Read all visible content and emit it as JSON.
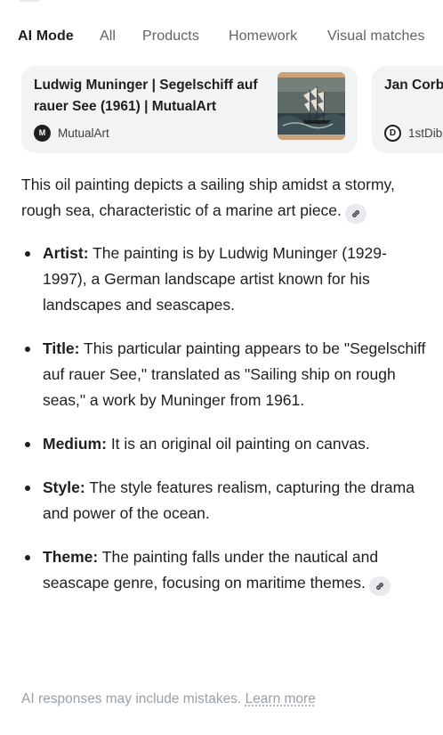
{
  "tabs": [
    {
      "label": "AI Mode",
      "active": true
    },
    {
      "label": "All",
      "active": false
    },
    {
      "label": "Products",
      "active": false
    },
    {
      "label": "Homework",
      "active": false
    },
    {
      "label": "Visual matches",
      "active": false
    }
  ],
  "cards": [
    {
      "title": "Ludwig Muninger | Segelschiff auf rauer See (1961) | MutualArt",
      "source": "MutualArt",
      "source_icon_letter": "M"
    },
    {
      "title": "Jan Corb Oil painti",
      "source": "1stDib",
      "source_icon_letter": "D"
    }
  ],
  "answer": {
    "intro": "This oil painting depicts a sailing ship amidst a stormy, rough sea, characteristic of a marine art piece.",
    "facts": [
      {
        "label": "Artist:",
        "text": " The painting is by Ludwig Muninger (1929-1997), a German landscape artist known for his landscapes and seascapes."
      },
      {
        "label": "Title:",
        "text": " This particular painting appears to be \"Segelschiff auf rauer See,\" translated as \"Sailing ship on rough seas,\" a work by Muninger from 1961."
      },
      {
        "label": "Medium:",
        "text": " It is an original oil painting on canvas."
      },
      {
        "label": "Style:",
        "text": " The style features realism, capturing the drama and power of the ocean."
      },
      {
        "label": "Theme:",
        "text": " The painting falls under the nautical and seascape genre, focusing on maritime themes."
      }
    ]
  },
  "footer": {
    "disclaimer": "AI responses may include mistakes.",
    "learn_more": "Learn more"
  },
  "icons": [
    "link-icon",
    "mutualart-logo-icon",
    "1stdibs-logo-icon"
  ]
}
